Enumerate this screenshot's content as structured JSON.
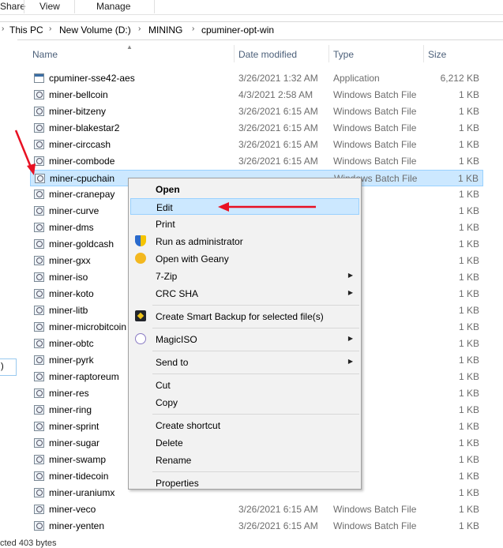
{
  "ribbon": {
    "tabs": [
      "Share",
      "View",
      "Manage"
    ]
  },
  "address": {
    "crumbs": [
      "This PC",
      "New Volume (D:)",
      "MINING",
      "cpuminer-opt-win"
    ]
  },
  "columns": {
    "name": "Name",
    "date": "Date modified",
    "type": "Type",
    "size": "Size"
  },
  "files": [
    {
      "name": "cpuminer-sse42-aes",
      "date": "3/26/2021 1:32 AM",
      "type": "Application",
      "size": "6,212 KB",
      "icon": "application-icon"
    },
    {
      "name": "miner-bellcoin",
      "date": "4/3/2021 2:58 AM",
      "type": "Windows Batch File",
      "size": "1 KB",
      "icon": "batch-file-icon"
    },
    {
      "name": "miner-bitzeny",
      "date": "3/26/2021 6:15 AM",
      "type": "Windows Batch File",
      "size": "1 KB",
      "icon": "batch-file-icon"
    },
    {
      "name": "miner-blakestar2",
      "date": "3/26/2021 6:15 AM",
      "type": "Windows Batch File",
      "size": "1 KB",
      "icon": "batch-file-icon"
    },
    {
      "name": "miner-circcash",
      "date": "3/26/2021 6:15 AM",
      "type": "Windows Batch File",
      "size": "1 KB",
      "icon": "batch-file-icon"
    },
    {
      "name": "miner-combode",
      "date": "3/26/2021 6:15 AM",
      "type": "Windows Batch File",
      "size": "1 KB",
      "icon": "batch-file-icon"
    },
    {
      "name": "miner-cpuchain",
      "date": "",
      "type": "Windows Batch File",
      "size": "1 KB",
      "icon": "batch-file-icon",
      "selected": true
    },
    {
      "name": "miner-cranepay",
      "date": "",
      "type": "",
      "size": "1 KB",
      "icon": "batch-file-icon"
    },
    {
      "name": "miner-curve",
      "date": "",
      "type": "",
      "size": "1 KB",
      "icon": "batch-file-icon"
    },
    {
      "name": "miner-dms",
      "date": "",
      "type": "",
      "size": "1 KB",
      "icon": "batch-file-icon"
    },
    {
      "name": "miner-goldcash",
      "date": "",
      "type": "",
      "size": "1 KB",
      "icon": "batch-file-icon"
    },
    {
      "name": "miner-gxx",
      "date": "",
      "type": "",
      "size": "1 KB",
      "icon": "batch-file-icon"
    },
    {
      "name": "miner-iso",
      "date": "",
      "type": "",
      "size": "1 KB",
      "icon": "batch-file-icon"
    },
    {
      "name": "miner-koto",
      "date": "",
      "type": "",
      "size": "1 KB",
      "icon": "batch-file-icon"
    },
    {
      "name": "miner-litb",
      "date": "",
      "type": "",
      "size": "1 KB",
      "icon": "batch-file-icon"
    },
    {
      "name": "miner-microbitcoin",
      "date": "",
      "type": "",
      "size": "1 KB",
      "icon": "batch-file-icon"
    },
    {
      "name": "miner-obtc",
      "date": "",
      "type": "",
      "size": "1 KB",
      "icon": "batch-file-icon"
    },
    {
      "name": "miner-pyrk",
      "date": "",
      "type": "",
      "size": "1 KB",
      "icon": "batch-file-icon"
    },
    {
      "name": "miner-raptoreum",
      "date": "",
      "type": "",
      "size": "1 KB",
      "icon": "batch-file-icon"
    },
    {
      "name": "miner-res",
      "date": "",
      "type": "",
      "size": "1 KB",
      "icon": "batch-file-icon"
    },
    {
      "name": "miner-ring",
      "date": "",
      "type": "",
      "size": "1 KB",
      "icon": "batch-file-icon"
    },
    {
      "name": "miner-sprint",
      "date": "",
      "type": "",
      "size": "1 KB",
      "icon": "batch-file-icon"
    },
    {
      "name": "miner-sugar",
      "date": "",
      "type": "",
      "size": "1 KB",
      "icon": "batch-file-icon"
    },
    {
      "name": "miner-swamp",
      "date": "",
      "type": "",
      "size": "1 KB",
      "icon": "batch-file-icon"
    },
    {
      "name": "miner-tidecoin",
      "date": "",
      "type": "",
      "size": "1 KB",
      "icon": "batch-file-icon"
    },
    {
      "name": "miner-uraniumx",
      "date": "",
      "type": "",
      "size": "1 KB",
      "icon": "batch-file-icon"
    },
    {
      "name": "miner-veco",
      "date": "3/26/2021 6:15 AM",
      "type": "Windows Batch File",
      "size": "1 KB",
      "icon": "batch-file-icon"
    },
    {
      "name": "miner-yenten",
      "date": "3/26/2021 6:15 AM",
      "type": "Windows Batch File",
      "size": "1 KB",
      "icon": "batch-file-icon"
    }
  ],
  "nav": {
    "selected_fragment": ")"
  },
  "status": {
    "text": "cted  403 bytes"
  },
  "context_menu": {
    "items": [
      {
        "label": "Open",
        "bold": true
      },
      {
        "label": "Edit",
        "highlighted": true
      },
      {
        "label": "Print"
      },
      {
        "label": "Run as administrator",
        "icon": "uac-shield-icon"
      },
      {
        "label": "Open with Geany",
        "icon": "geany-icon"
      },
      {
        "label": "7-Zip",
        "submenu": true
      },
      {
        "label": "CRC SHA",
        "submenu": true
      },
      {
        "separator": true
      },
      {
        "label": "Create Smart Backup for selected file(s)",
        "icon": "smart-backup-icon"
      },
      {
        "separator": true
      },
      {
        "label": "MagicISO",
        "icon": "magiciso-icon",
        "submenu": true
      },
      {
        "separator": true
      },
      {
        "label": "Send to",
        "submenu": true
      },
      {
        "separator": true
      },
      {
        "label": "Cut"
      },
      {
        "label": "Copy"
      },
      {
        "separator": true
      },
      {
        "label": "Create shortcut"
      },
      {
        "label": "Delete"
      },
      {
        "label": "Rename"
      },
      {
        "separator": true
      },
      {
        "label": "Properties"
      }
    ]
  },
  "annotations": {
    "arrow_color": "#e81123"
  },
  "colors": {
    "selection_bg": "#cce8ff",
    "selection_border": "#99d1ff",
    "menu_bg": "#f2f2f2",
    "header_text": "#4c607a"
  }
}
